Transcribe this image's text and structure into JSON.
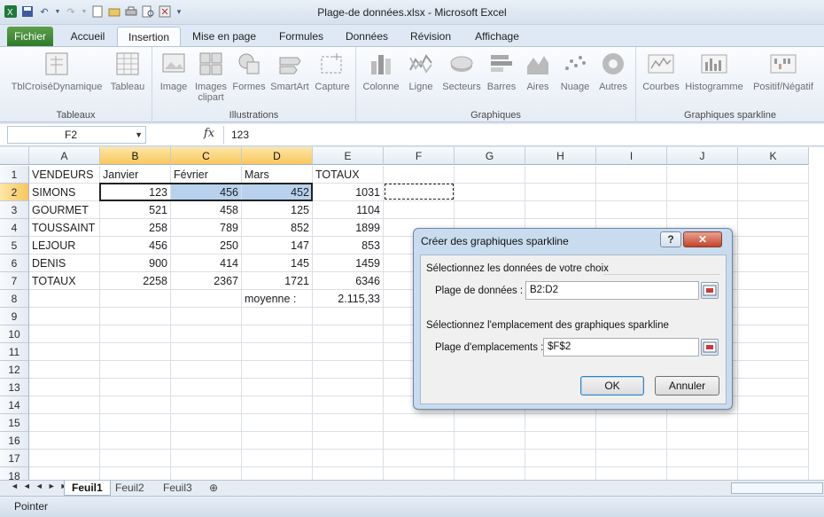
{
  "window": {
    "title": "Plage-de données.xlsx  -  Microsoft Excel"
  },
  "qat": {
    "icons": [
      "excel-logo-icon",
      "save-icon",
      "undo-icon",
      "redo-icon",
      "new-icon",
      "open-icon",
      "print-icon",
      "preview-icon",
      "clear-icon",
      "customize-icon"
    ]
  },
  "tabs": [
    "Fichier",
    "Accueil",
    "Insertion",
    "Mise en page",
    "Formules",
    "Données",
    "Révision",
    "Affichage"
  ],
  "active_tab": "Insertion",
  "ribbon": {
    "groups": [
      {
        "label": "Tableaux",
        "buttons": [
          "TblCroiséDynamique",
          "Tableau"
        ]
      },
      {
        "label": "Illustrations",
        "buttons": [
          "Image",
          "Images clipart",
          "Formes",
          "SmartArt",
          "Capture"
        ]
      },
      {
        "label": "Graphiques",
        "buttons": [
          "Colonne",
          "Ligne",
          "Secteurs",
          "Barres",
          "Aires",
          "Nuage",
          "Autres"
        ]
      },
      {
        "label": "Graphiques sparkline",
        "buttons": [
          "Courbes",
          "Histogramme",
          "Positif/Négatif"
        ]
      }
    ]
  },
  "formula_bar": {
    "name_box": "F2",
    "fx": "fx",
    "value": "123"
  },
  "columns": [
    "A",
    "B",
    "C",
    "D",
    "E",
    "F",
    "G",
    "H",
    "I",
    "J",
    "K"
  ],
  "rows": [
    "1",
    "2",
    "3",
    "4",
    "5",
    "6",
    "7",
    "8",
    "9",
    "10",
    "11",
    "12",
    "13",
    "14",
    "15",
    "16",
    "17",
    "18"
  ],
  "cells": {
    "r1": [
      "VENDEURS",
      "Janvier",
      "Février",
      "Mars",
      "TOTAUX"
    ],
    "r2": [
      "SIMONS",
      "123",
      "456",
      "452",
      "1031"
    ],
    "r3": [
      "GOURMET",
      "521",
      "458",
      "125",
      "1104"
    ],
    "r4": [
      "TOUSSAINT",
      "258",
      "789",
      "852",
      "1899"
    ],
    "r5": [
      "LEJOUR",
      "456",
      "250",
      "147",
      "853"
    ],
    "r6": [
      "DENIS",
      "900",
      "414",
      "145",
      "1459"
    ],
    "r7": [
      "TOTAUX",
      "2258",
      "2367",
      "1721",
      "6346"
    ],
    "r8_label": "moyenne :",
    "r8_value": "2.115,33"
  },
  "sheets": [
    "Feuil1",
    "Feuil2",
    "Feuil3"
  ],
  "active_sheet": "Feuil1",
  "status": "Pointer",
  "dialog": {
    "title": "Créer des graphiques sparkline",
    "help": "?",
    "close": "✕",
    "section1": "Sélectionnez les données de votre choix",
    "data_range_label": "Plage de données :",
    "data_range_value": "B2:D2",
    "section2": "Sélectionnez l'emplacement des graphiques sparkline",
    "location_label": "Plage d'emplacements :",
    "location_value": "$F$2",
    "ok": "OK",
    "cancel": "Annuler"
  },
  "colors": {
    "accent": "#f9c75d",
    "file_tab": "#2f7a2b",
    "selection": "#b8d2ee"
  }
}
